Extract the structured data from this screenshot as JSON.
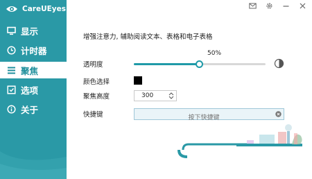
{
  "app": {
    "title": "CareUEyes"
  },
  "window_controls": [
    {
      "name": "mail-icon"
    },
    {
      "name": "gear-icon"
    },
    {
      "name": "minimize-icon"
    },
    {
      "name": "close-icon"
    }
  ],
  "sidebar": {
    "items": [
      {
        "label": "显示",
        "icon": "monitor-icon",
        "active": false
      },
      {
        "label": "计时器",
        "icon": "clock-icon",
        "active": false
      },
      {
        "label": "聚焦",
        "icon": "focus-list-icon",
        "active": true
      },
      {
        "label": "选项",
        "icon": "options-icon",
        "active": false
      },
      {
        "label": "关于",
        "icon": "info-icon",
        "active": false
      }
    ]
  },
  "focus": {
    "description": "增强注意力, 辅助阅读文本、表格和电子表格",
    "opacity": {
      "label": "透明度",
      "value_text": "50%",
      "value": 0.5
    },
    "color": {
      "label": "颜色选择",
      "value": "#000000"
    },
    "height": {
      "label": "聚焦高度",
      "value": "300"
    },
    "hotkey": {
      "label": "快捷键",
      "placeholder": "按下快捷键"
    }
  },
  "colors": {
    "accent": "#2a99a6",
    "slider": "#1f9aa8"
  }
}
